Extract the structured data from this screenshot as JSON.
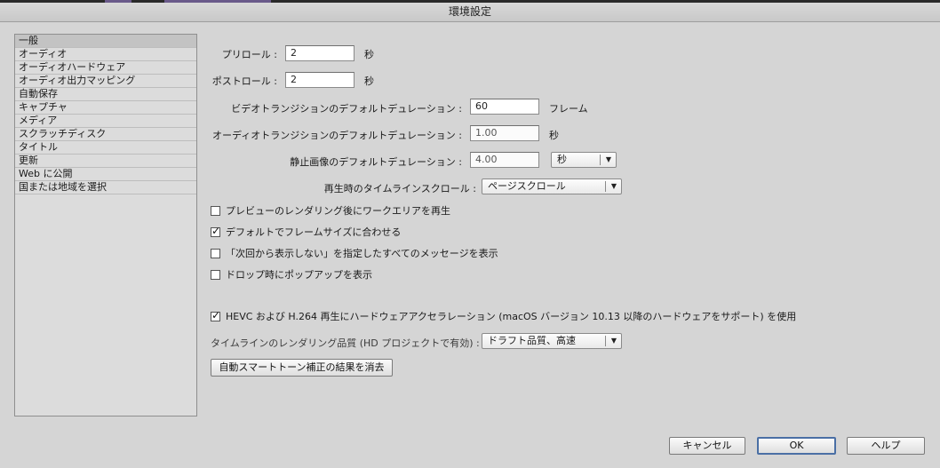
{
  "window": {
    "title": "環境設定"
  },
  "sidebar": {
    "items": [
      {
        "label": "一般",
        "selected": true
      },
      {
        "label": "オーディオ"
      },
      {
        "label": "オーディオハードウェア"
      },
      {
        "label": "オーディオ出力マッピング"
      },
      {
        "label": "自動保存"
      },
      {
        "label": "キャプチャ"
      },
      {
        "label": "メディア"
      },
      {
        "label": "スクラッチディスク"
      },
      {
        "label": "タイトル"
      },
      {
        "label": "更新"
      },
      {
        "label": "Web に公開"
      },
      {
        "label": "国または地域を選択"
      }
    ]
  },
  "general": {
    "preroll": {
      "label": "プリロール :",
      "value": "2",
      "unit": "秒"
    },
    "postroll": {
      "label": "ポストロール :",
      "value": "2",
      "unit": "秒"
    },
    "video_transition": {
      "label": "ビデオトランジションのデフォルトデュレーション :",
      "value": "60",
      "unit": "フレーム"
    },
    "audio_transition": {
      "label": "オーディオトランジションのデフォルトデュレーション :",
      "value": "1.00",
      "unit": "秒"
    },
    "still_image": {
      "label": "静止画像のデフォルトデュレーション :",
      "value": "4.00",
      "unit_select": "秒"
    },
    "timeline_scroll": {
      "label": "再生時のタイムラインスクロール :",
      "value": "ページスクロール"
    },
    "checkboxes": [
      {
        "label": "プレビューのレンダリング後にワークエリアを再生",
        "checked": false
      },
      {
        "label": "デフォルトでフレームサイズに合わせる",
        "checked": true
      },
      {
        "label": "「次回から表示しない」を指定したすべてのメッセージを表示",
        "checked": false
      },
      {
        "label": "ドロップ時にポップアップを表示",
        "checked": false
      }
    ],
    "hevc": {
      "label": "HEVC および H.264 再生にハードウェアアクセラレーション (macOS バージョン 10.13 以降のハードウェアをサポート) を使用",
      "checked": true
    },
    "render_quality": {
      "label": "タイムラインのレンダリング品質 (HD プロジェクトで有効) :",
      "value": "ドラフト品質、高速"
    },
    "clear_smart_tone_label": "自動スマートトーン補正の結果を消去"
  },
  "footer": {
    "cancel": "キャンセル",
    "ok": "OK",
    "help": "ヘルプ"
  },
  "colors": {
    "window_bg": "#d5d5d5",
    "default_button_border": "#4a6fa5"
  }
}
